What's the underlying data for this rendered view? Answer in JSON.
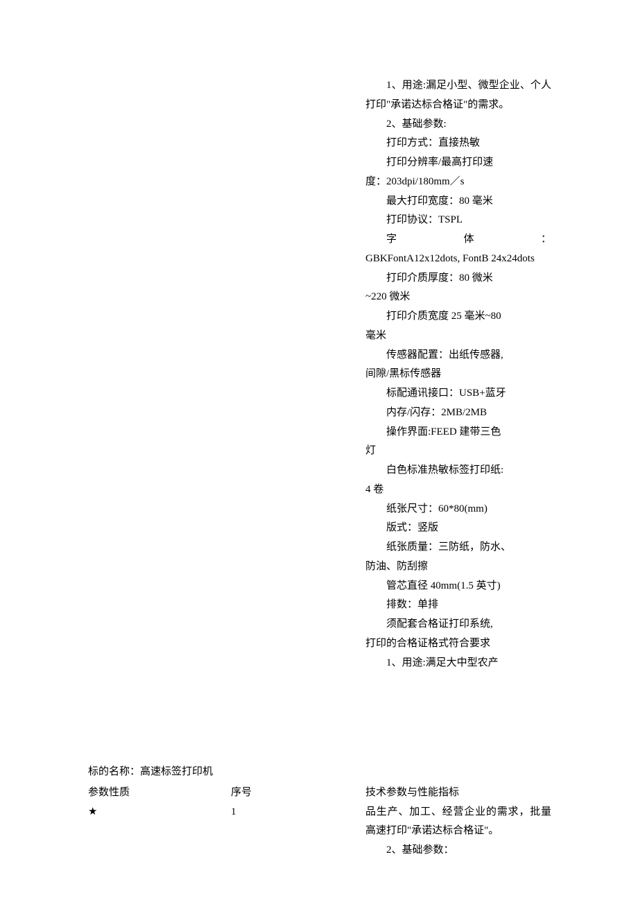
{
  "spec_block": {
    "p1": "1、用途:漏足小型、微型企业、个人打印\"承诺达标合格证\"的需求。",
    "p2": "2、基础参数:",
    "p3": "打印方式：直接热敏",
    "p4": "打印分辨率/最高打印速度：203dpi/180mm／s",
    "p4a": "打印分辨率/最高打印速",
    "p4b": "度：203dpi/180mm／s",
    "p5": "最大打印宽度：80 毫米",
    "p6": "打印协议：TSPL",
    "p7a_l": "字",
    "p7a_m": "体",
    "p7a_r": "：",
    "p7b": "GBKFontA12x12dots,  FontB 24x24dots",
    "p8a": "打印介质厚度：80 微米",
    "p8b": "~220 微米",
    "p9a": "打印介质宽度 25 毫米~80",
    "p9b": "毫米",
    "p10a": "传感器配置：出纸传感器,",
    "p10b": "间隙/黑标传感器",
    "p11": "标配通讯接口：USB+蓝牙",
    "p12": "内存/闪存：2MB/2MB",
    "p13a": "操作界面:FEED 建带三色",
    "p13b": "灯",
    "p14a": "白色标准热敏标签打印纸:",
    "p14b": "4 卷",
    "p15": "纸张尺寸：60*80(mm)",
    "p16": "版式：竖版",
    "p17a": "纸张质量：三防纸，防水、",
    "p17b": "防油、防刮擦",
    "p18": "管芯直径 40mm(1.5 英寸)",
    "p19": "排数：单排",
    "p20a": "须配套合格证打印系统,",
    "p20b": "打印的合格证格式符合要求",
    "p21": "1、用途:满足大中型农产"
  },
  "bottom": {
    "title_label": "标的名称：",
    "title_value": "高速标签打印机",
    "col1_label": "参数性质",
    "col1_value": "★",
    "col2_label": "序号",
    "col2_value": "1",
    "col3_label": "技术参数与性能指标",
    "col3_p1a": "品生产、加工、经营企业的需求，批量高速打印\"承诺达标合格证\"。",
    "col3_p2": "2、基础参数："
  }
}
